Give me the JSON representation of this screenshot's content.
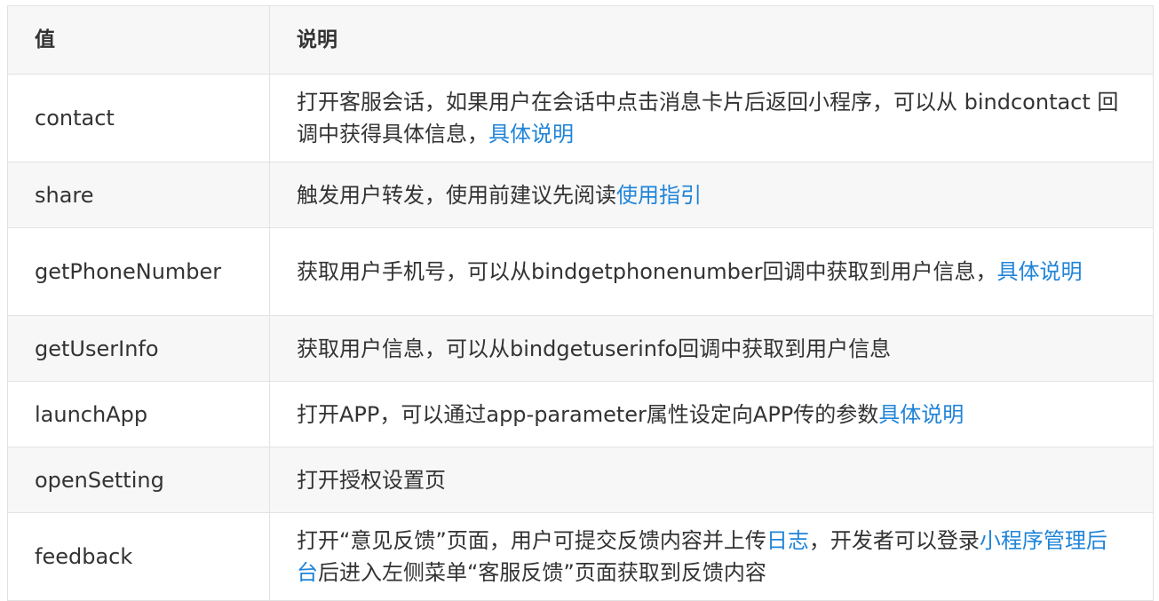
{
  "table": {
    "headers": [
      "值",
      "说明"
    ],
    "rows": [
      {
        "value": "contact",
        "desc": [
          {
            "text": "打开客服会话，如果用户在会话中点击消息卡片后返回小程序，可以从 bindcontact 回调中获得具体信息，"
          },
          {
            "text": "具体说明",
            "link": true
          }
        ]
      },
      {
        "value": "share",
        "desc": [
          {
            "text": "触发用户转发，使用前建议先阅读"
          },
          {
            "text": "使用指引",
            "link": true
          }
        ]
      },
      {
        "value": "getPhoneNumber",
        "desc": [
          {
            "text": "获取用户手机号，可以从bindgetphonenumber回调中获取到用户信息，"
          },
          {
            "text": "具体说明",
            "link": true
          }
        ]
      },
      {
        "value": "getUserInfo",
        "desc": [
          {
            "text": "获取用户信息，可以从bindgetuserinfo回调中获取到用户信息"
          }
        ]
      },
      {
        "value": "launchApp",
        "desc": [
          {
            "text": "打开APP，可以通过app-parameter属性设定向APP传的参数"
          },
          {
            "text": "具体说明",
            "link": true
          }
        ]
      },
      {
        "value": "openSetting",
        "desc": [
          {
            "text": "打开授权设置页"
          }
        ]
      },
      {
        "value": "feedback",
        "desc": [
          {
            "text": "打开“意见反馈”页面，用户可提交反馈内容并上传"
          },
          {
            "text": "日志",
            "link": true
          },
          {
            "text": "，开发者可以登录"
          },
          {
            "text": "小程序管理后台",
            "link": true
          },
          {
            "text": "后进入左侧菜单“客服反馈”页面获取到反馈内容"
          }
        ]
      }
    ]
  },
  "colors": {
    "link": "#1f84d8",
    "text": "#333333",
    "header_bg": "#f7f7f7",
    "stripe_bg": "#f7f7f7",
    "border": "#e2e2e2"
  }
}
